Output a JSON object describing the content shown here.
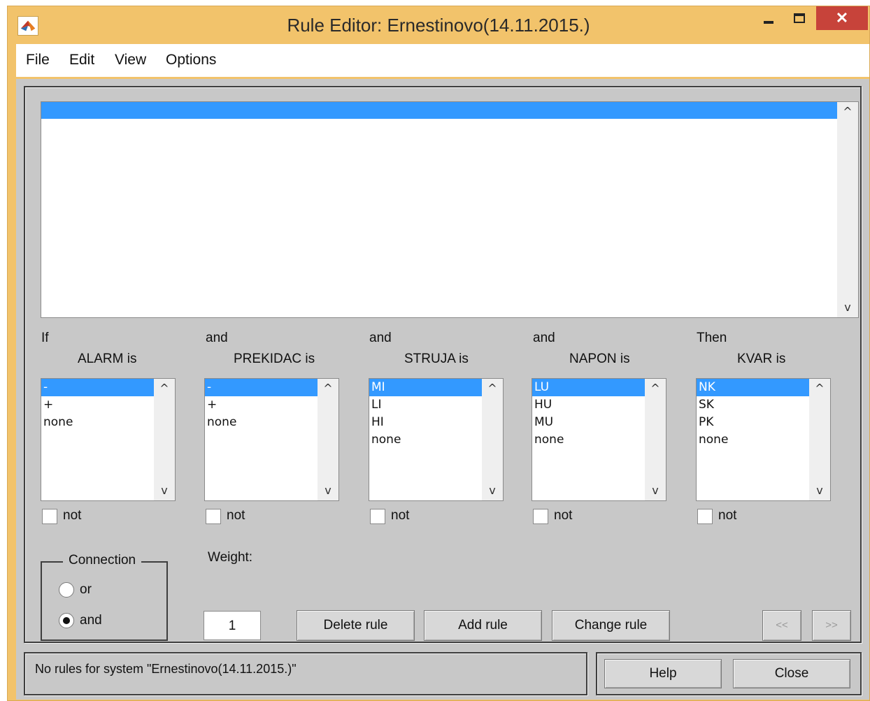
{
  "window": {
    "title": "Rule Editor: Ernestinovo(14.11.2015.)",
    "close_glyph": "✕"
  },
  "menu": [
    "File",
    "Edit",
    "View",
    "Options"
  ],
  "rules_list": {
    "items": []
  },
  "inputs": [
    {
      "prefix": "If",
      "label": "ALARM is",
      "items": [
        "-",
        "+",
        "none"
      ],
      "selected": 0,
      "not_label": "not",
      "not_checked": false
    },
    {
      "prefix": "and",
      "label": "PREKIDAC is",
      "items": [
        "-",
        "+",
        "none"
      ],
      "selected": 0,
      "not_label": "not",
      "not_checked": false
    },
    {
      "prefix": "and",
      "label": "STRUJA is",
      "items": [
        "MI",
        "LI",
        "HI",
        "none"
      ],
      "selected": 0,
      "not_label": "not",
      "not_checked": false
    },
    {
      "prefix": "and",
      "label": "NAPON is",
      "items": [
        "LU",
        "HU",
        "MU",
        "none"
      ],
      "selected": 0,
      "not_label": "not",
      "not_checked": false
    }
  ],
  "output": {
    "prefix": "Then",
    "label": "KVAR is",
    "items": [
      "NK",
      "SK",
      "PK",
      "none"
    ],
    "selected": 0,
    "not_label": "not",
    "not_checked": false
  },
  "connection": {
    "title": "Connection",
    "or_label": "or",
    "and_label": "and",
    "selected": "and"
  },
  "weight": {
    "label": "Weight:",
    "value": "1"
  },
  "buttons": {
    "delete": "Delete rule",
    "add": "Add rule",
    "change": "Change rule",
    "prev": "<<",
    "next": ">>"
  },
  "status": "No rules for system \"Ernestinovo(14.11.2015.)\"",
  "footer": {
    "help": "Help",
    "close": "Close"
  },
  "icons": {
    "scroll_up": "^",
    "scroll_down": "v"
  },
  "colors": {
    "title_bar": "#f2c36b",
    "selection": "#3399ff",
    "close_button": "#c7433a",
    "client_bg": "#c8c8c8"
  }
}
